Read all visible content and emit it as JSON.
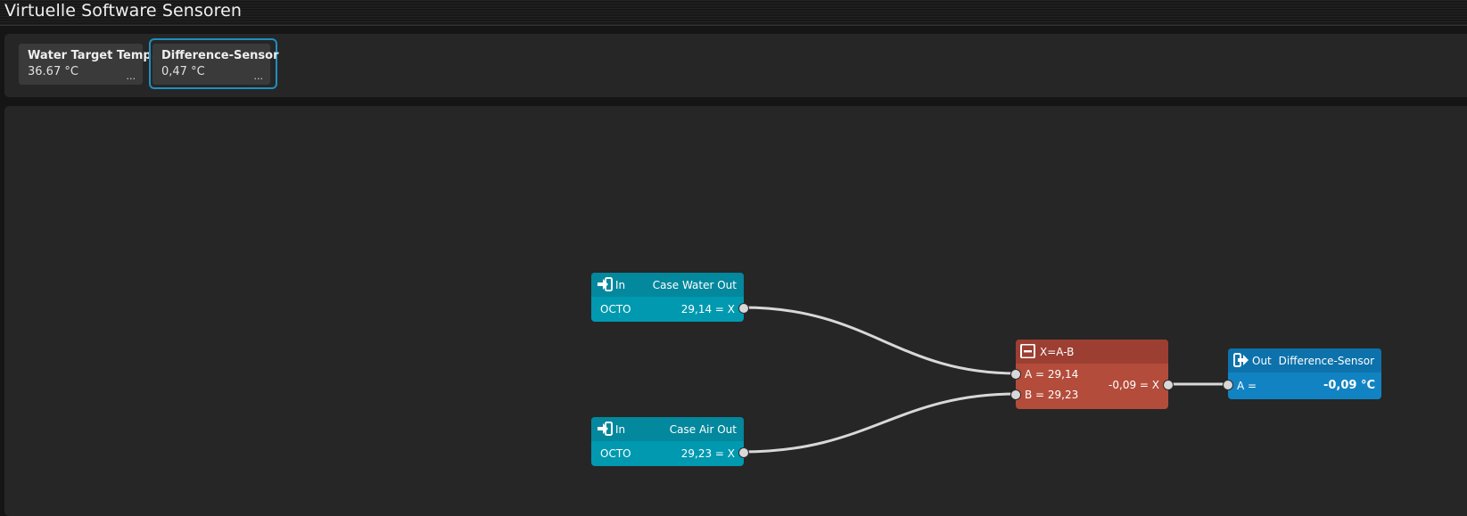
{
  "app": {
    "title": "Virtuelle Software Sensoren"
  },
  "sensors": [
    {
      "name": "Water Target Temp.",
      "value": "36.67 °C",
      "more": "..."
    },
    {
      "name": "Difference-Sensor",
      "value": "0,47 °C",
      "more": "...",
      "selected": true
    }
  ],
  "nodes": {
    "input_water": {
      "kind": "In",
      "label": "Case Water Out",
      "source": "OCTO",
      "output": "29,14 = X",
      "icon": "input-arrow-icon"
    },
    "input_air": {
      "kind": "In",
      "label": "Case Air Out",
      "source": "OCTO",
      "output": "29,23 = X",
      "icon": "input-arrow-icon"
    },
    "operation": {
      "formula": "X=A-B",
      "input_a": "A = 29,14",
      "input_b": "B = 29,23",
      "output": "-0,09 = X",
      "icon": "minus-box-icon"
    },
    "output": {
      "kind": "Out",
      "label": "Difference-Sensor",
      "input": "A =",
      "value": "-0,09 °C",
      "icon": "output-arrow-icon"
    }
  },
  "colors": {
    "input_node": "#0099b0",
    "operation_node": "#b44c3b",
    "output_node": "#1283c2",
    "selection_ring": "#1e8fc0",
    "wire": "#d8d8d8"
  }
}
